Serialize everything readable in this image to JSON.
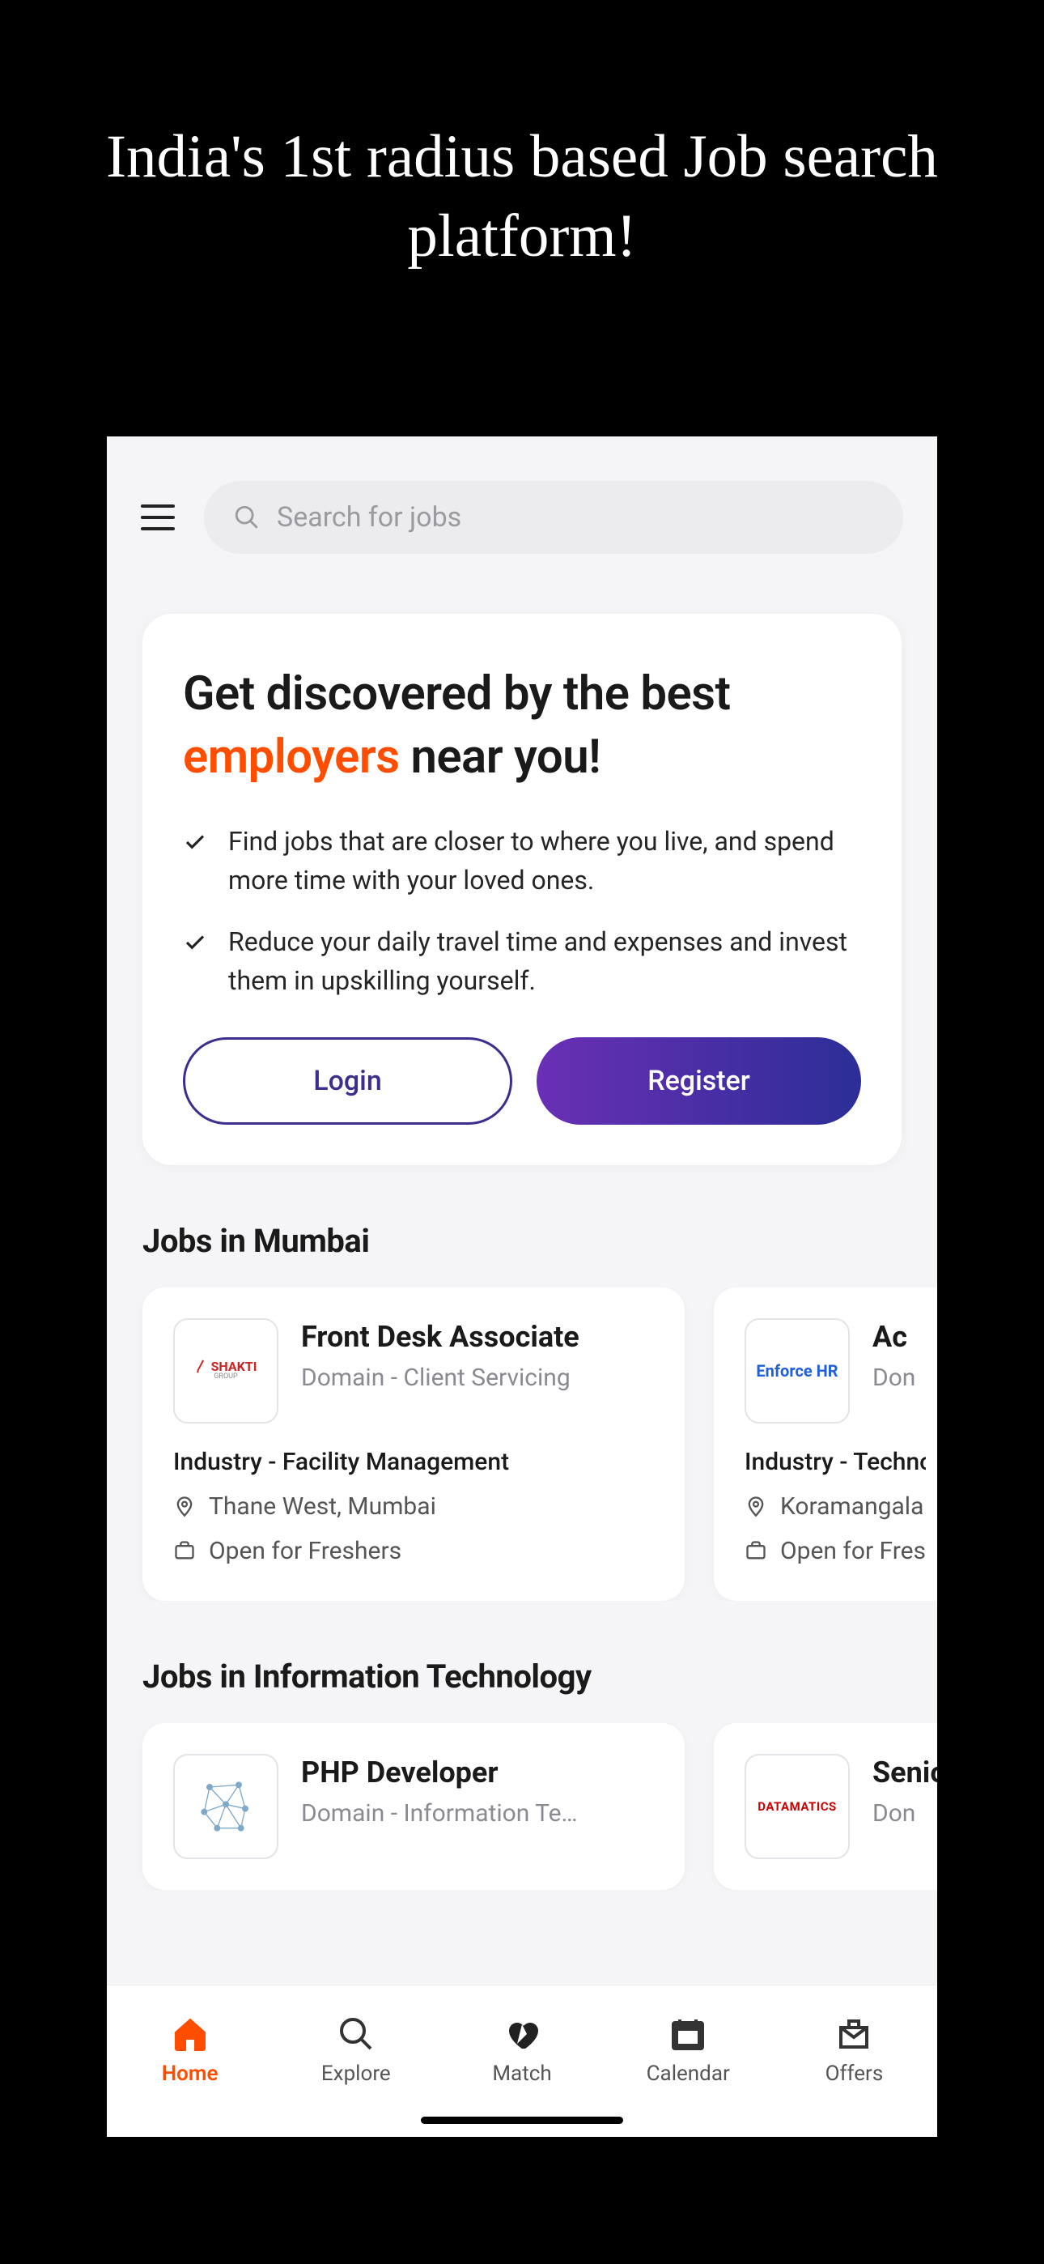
{
  "outer_title": "India's 1st radius based Job search platform!",
  "search": {
    "placeholder": "Search for jobs"
  },
  "hero": {
    "t1": "Get discovered by the best ",
    "t2": "employers",
    "t3": " near you!",
    "b1": "Find jobs that are closer to where you live, and spend more time with your loved ones.",
    "b2": "Reduce your daily travel time and expenses and invest them in upskilling yourself.",
    "login": "Login",
    "register": "Register"
  },
  "sections": [
    {
      "heading": "Jobs in Mumbai",
      "cards": [
        {
          "logo_key": "shakti",
          "title": "Front Desk Associate",
          "domain": "Domain - Client Servicing",
          "industry": "Industry - Facility Management",
          "location": "Thane West, Mumbai",
          "exp": "Open for Freshers"
        },
        {
          "logo_key": "enforce",
          "title": "Ac",
          "domain": "Don",
          "industry": "Industry - Technology Services",
          "location": "Koramangala",
          "exp": "Open for Freshers"
        }
      ]
    },
    {
      "heading": "Jobs in Information Technology",
      "cards": [
        {
          "logo_key": "net",
          "title": "PHP Developer",
          "domain": "Domain - Information Te…",
          "industry": "",
          "location": "",
          "exp": ""
        },
        {
          "logo_key": "datamatics",
          "title": "Senior iOS",
          "domain": "Don",
          "industry": "",
          "location": "",
          "exp": ""
        }
      ]
    }
  ],
  "logos": {
    "shakti_main": "SHAKTI",
    "shakti_sub": "GROUP",
    "enforce": "Enforce HR",
    "datamatics": "DATAMATICS"
  },
  "tabs": {
    "home": "Home",
    "explore": "Explore",
    "match": "Match",
    "calendar": "Calendar",
    "offers": "Offers"
  }
}
